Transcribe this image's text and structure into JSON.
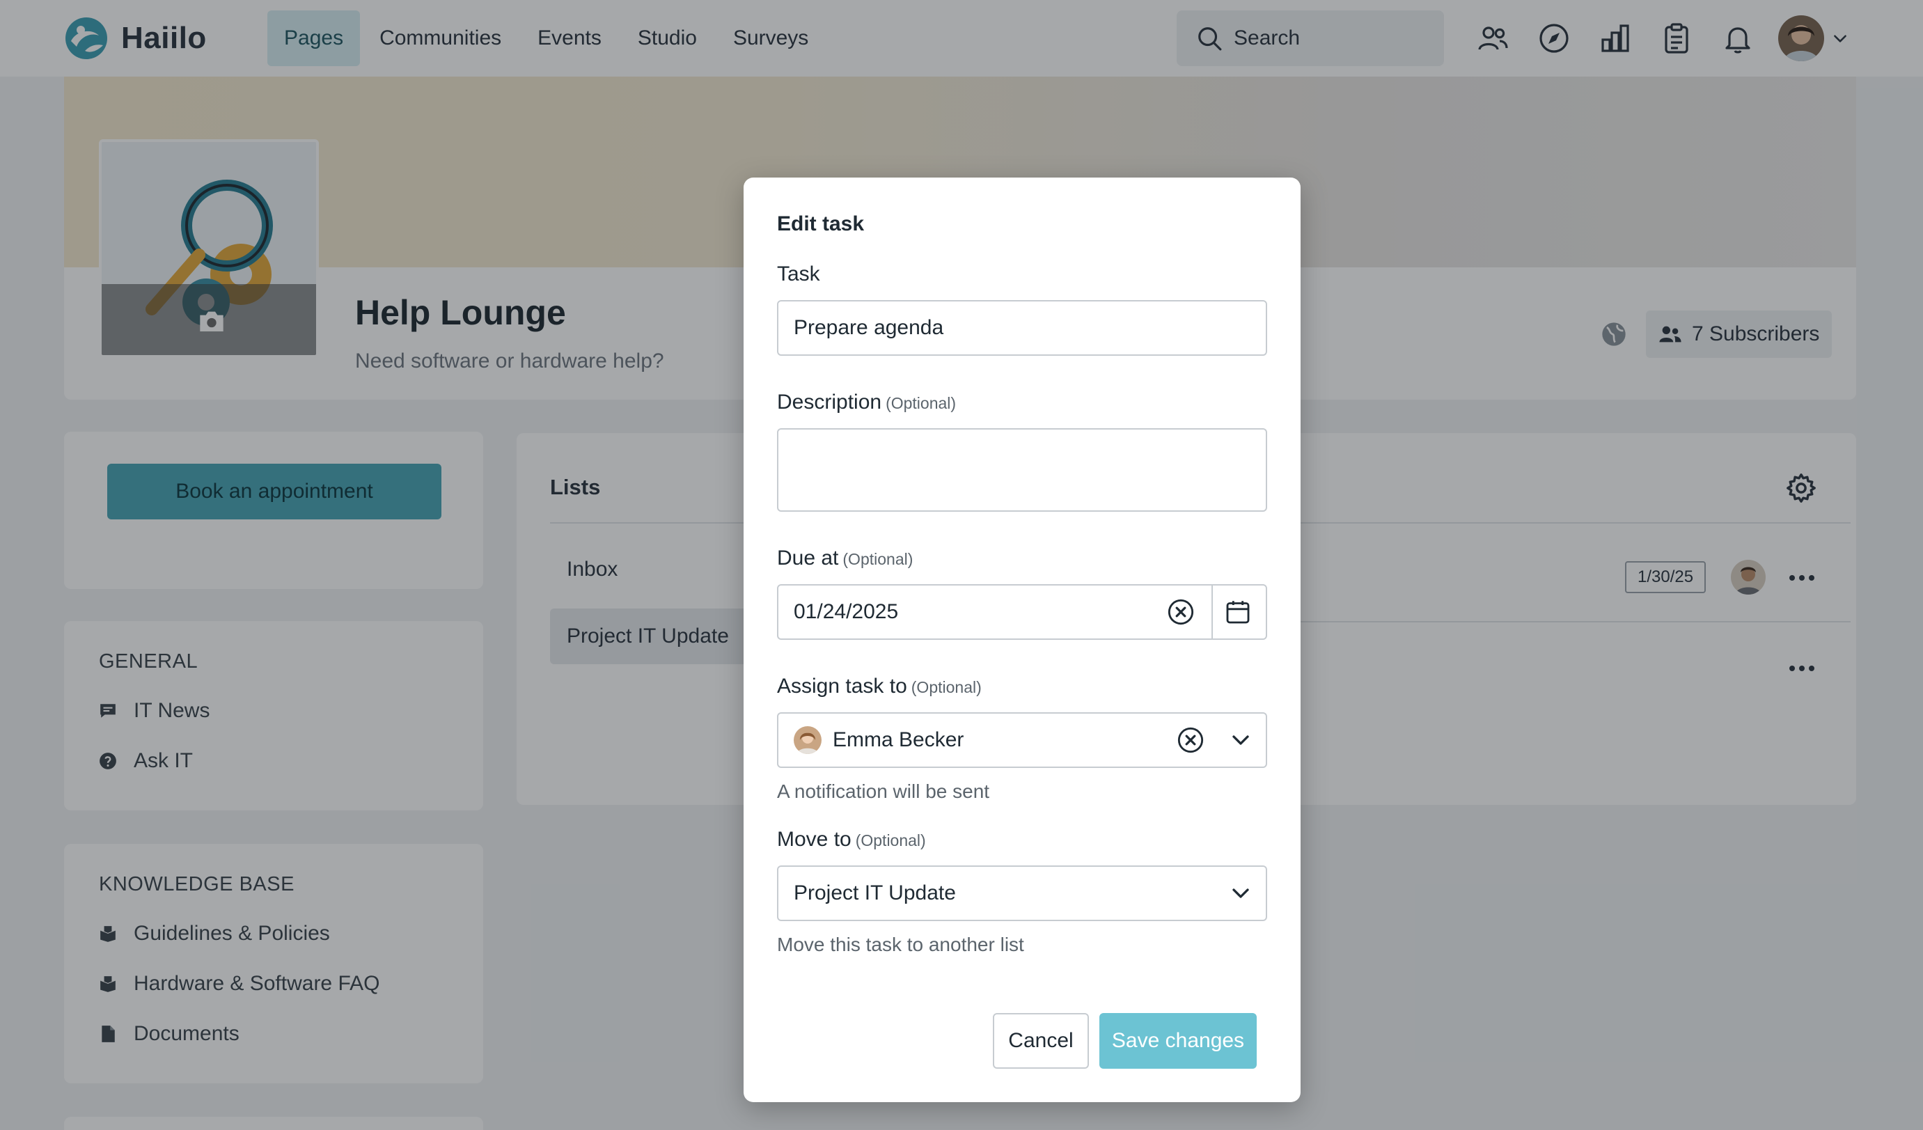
{
  "header": {
    "brand": "Haiilo",
    "nav": [
      "Pages",
      "Communities",
      "Events",
      "Studio",
      "Surveys"
    ],
    "active_nav": "Pages",
    "search_placeholder": "Search",
    "icons": [
      "people-icon",
      "compass-icon",
      "chart-icon",
      "clipboard-icon",
      "bell-icon"
    ],
    "accent_color": "#4aa5b5"
  },
  "page": {
    "title": "Help Lounge",
    "subtitle": "Need software or hardware help?",
    "subscribers": "7 Subscribers"
  },
  "sidebar": {
    "book_button": "Book an appointment",
    "general": {
      "heading": "GENERAL",
      "items": [
        {
          "label": "IT News",
          "icon": "chat-icon"
        },
        {
          "label": "Ask IT",
          "icon": "help-icon"
        }
      ]
    },
    "knowledge": {
      "heading": "KNOWLEDGE BASE",
      "items": [
        {
          "label": "Guidelines & Policies",
          "icon": "book-icon"
        },
        {
          "label": "Hardware & Software FAQ",
          "icon": "book-icon"
        },
        {
          "label": "Documents",
          "icon": "document-icon"
        }
      ]
    }
  },
  "lists": {
    "title": "Lists",
    "items": [
      "Inbox",
      "Project IT Update"
    ],
    "active": "Project IT Update",
    "task_due": "1/30/25"
  },
  "modal": {
    "title": "Edit task",
    "task_label": "Task",
    "task_value": "Prepare agenda",
    "description_label": "Description",
    "optional": "(Optional)",
    "due_label": "Due at",
    "due_value": "01/24/2025",
    "assign_label": "Assign task to",
    "assign_value": "Emma Becker",
    "assign_hint": "A notification will be sent",
    "move_label": "Move to",
    "move_value": "Project IT Update",
    "move_hint": "Move this task to another list",
    "cancel_label": "Cancel",
    "save_label": "Save changes"
  }
}
